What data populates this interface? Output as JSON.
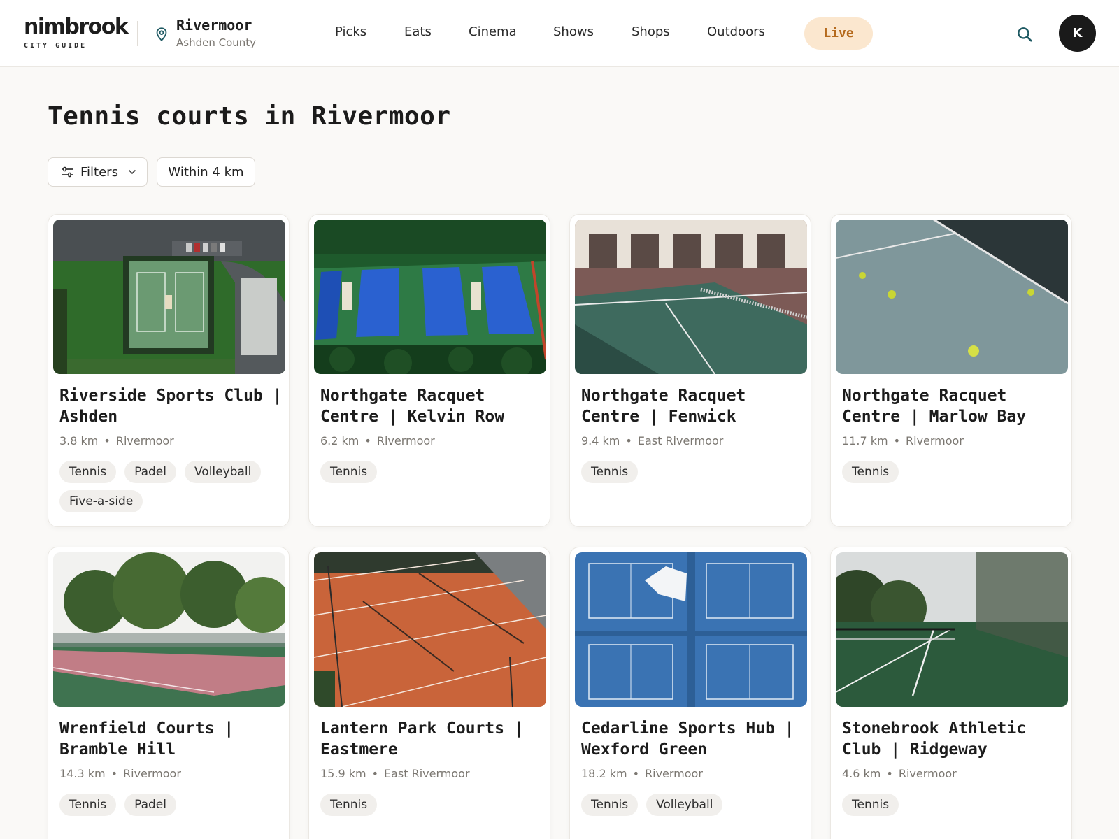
{
  "brand": {
    "name": "nimbrook",
    "tagline": "CITY GUIDE"
  },
  "location": {
    "city": "Rivermoor",
    "county": "Ashden County",
    "icon": "map-pin-icon"
  },
  "nav": {
    "items": [
      "Picks",
      "Eats",
      "Cinema",
      "Shows",
      "Shops",
      "Outdoors"
    ],
    "live": "Live"
  },
  "user": {
    "initial": "K"
  },
  "page": {
    "title": "Tennis courts in Rivermoor"
  },
  "filters": {
    "filters_label": "Filters",
    "radius_label": "Within 4 km"
  },
  "colors": {
    "accent_bg": "#fbe7cf",
    "accent_text": "#b56a1d",
    "avatar_bg": "#1a1a1a"
  },
  "venues": [
    {
      "name": "Riverside Sports Club | Ashden",
      "distance": "3.8 km",
      "area": "Rivermoor",
      "tags": [
        "Tennis",
        "Padel",
        "Volleyball",
        "Five-a-side"
      ],
      "photo": "aerial-park-courts"
    },
    {
      "name": "Northgate Racquet Centre | Kelvin Row",
      "distance": "6.2 km",
      "area": "Rivermoor",
      "tags": [
        "Tennis"
      ],
      "photo": "aerial-blue-courts"
    },
    {
      "name": "Northgate Racquet Centre | Fenwick",
      "distance": "9.4 km",
      "area": "East Rivermoor",
      "tags": [
        "Tennis"
      ],
      "photo": "indoor-court-net"
    },
    {
      "name": "Northgate Racquet Centre | Marlow Bay",
      "distance": "11.7 km",
      "area": "Rivermoor",
      "tags": [
        "Tennis"
      ],
      "photo": "balls-near-net"
    },
    {
      "name": "Wrenfield Courts | Bramble Hill",
      "distance": "14.3 km",
      "area": "Rivermoor",
      "tags": [
        "Tennis",
        "Padel"
      ],
      "photo": "pink-court-trees"
    },
    {
      "name": "Lantern Park Courts | Eastmere",
      "distance": "15.9 km",
      "area": "East Rivermoor",
      "tags": [
        "Tennis"
      ],
      "photo": "clay-courts-aerial"
    },
    {
      "name": "Cedarline Sports Hub | Wexford Green",
      "distance": "18.2 km",
      "area": "Rivermoor",
      "tags": [
        "Tennis",
        "Volleyball"
      ],
      "photo": "blue-courts-topdown"
    },
    {
      "name": "Stonebrook Athletic Club | Ridgeway",
      "distance": "4.6 km",
      "area": "Rivermoor",
      "tags": [
        "Tennis"
      ],
      "photo": "green-court-fence"
    }
  ]
}
